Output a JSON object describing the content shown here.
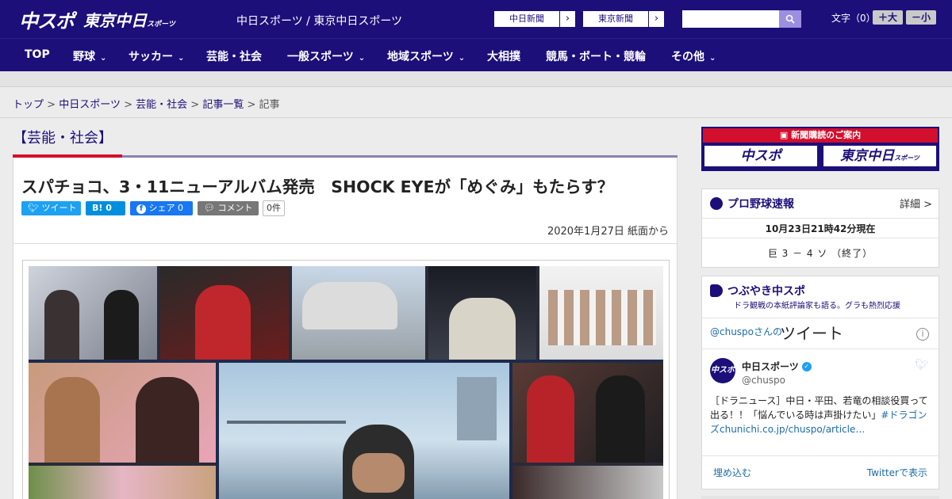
{
  "header": {
    "logo_main": "中スポ",
    "logo_tokyo": "東京中日",
    "logo_tokyo_small": "スポーツ",
    "site_name": "中日スポーツ / 東京中日スポーツ",
    "paper_links": [
      {
        "label": "中日新聞",
        "arrow": "›"
      },
      {
        "label": "東京新聞",
        "arrow": "›"
      }
    ],
    "search_placeholder": "",
    "font_size_label": "文字（0）",
    "font_larger": "＋大",
    "font_smaller": "－小"
  },
  "nav": {
    "items": [
      {
        "label": "TOP",
        "chevron": ""
      },
      {
        "label": "野球",
        "chevron": "⌄"
      },
      {
        "label": "サッカー",
        "chevron": "⌄"
      },
      {
        "label": "芸能・社会",
        "chevron": ""
      },
      {
        "label": "一般スポーツ",
        "chevron": "⌄"
      },
      {
        "label": "地域スポーツ",
        "chevron": "⌄"
      },
      {
        "label": "大相撲",
        "chevron": ""
      },
      {
        "label": "競馬・ボート・競輪",
        "chevron": ""
      },
      {
        "label": "その他",
        "chevron": "⌄"
      }
    ]
  },
  "breadcrumb": {
    "items": [
      "トップ",
      "中日スポーツ",
      "芸能・社会",
      "記事一覧"
    ],
    "separator": ">",
    "current": "記事"
  },
  "article": {
    "section": "【芸能・社会】",
    "headline": "スパチョコ、3・11ニューアルバム発売　SHOCK EYEが「めぐみ」もたらす？",
    "share": {
      "tweet": "ツイート",
      "hatena_label": "B!",
      "hatena_count": "0",
      "facebook": "シェア",
      "facebook_count": "0",
      "comment": "コメント",
      "comment_count": "0件"
    },
    "date": "2020年1月27日 紙面から"
  },
  "sidebar": {
    "promo_title": "新聞購読のご案内",
    "promo_logo_1": "中スポ",
    "promo_logo_2": "東京中日",
    "promo_logo_2_small": "スポーツ",
    "baseball": {
      "title": "プロ野球速報",
      "detail": "詳細 >",
      "time": "10月23日21時42分現在",
      "score": "巨 3 － 4 ソ （終了）"
    },
    "tweets": {
      "title": "つぶやき中スポ",
      "subtitle": "ドラ観戦の本紙評論家も語る。グラも熱烈応援",
      "head_user": "@chuspoさんの",
      "head_label": "ツイート",
      "info": "i",
      "avatar_text": "中スポ",
      "name": "中日スポーツ",
      "handle": "@chuspo",
      "body_text": "［ドラニュース］中日・平田、若竜の相談役買って出る！！「悩んでいる時は声掛けたい」",
      "body_link": "#ドラゴンズchunichi.co.jp/chuspo/article…",
      "embed": "埋め込む",
      "view_on": "Twitterで表示"
    }
  },
  "colors": {
    "brand_navy": "#1c0f7a",
    "brand_red": "#d20f2d",
    "twitter_blue": "#1da1f2"
  }
}
